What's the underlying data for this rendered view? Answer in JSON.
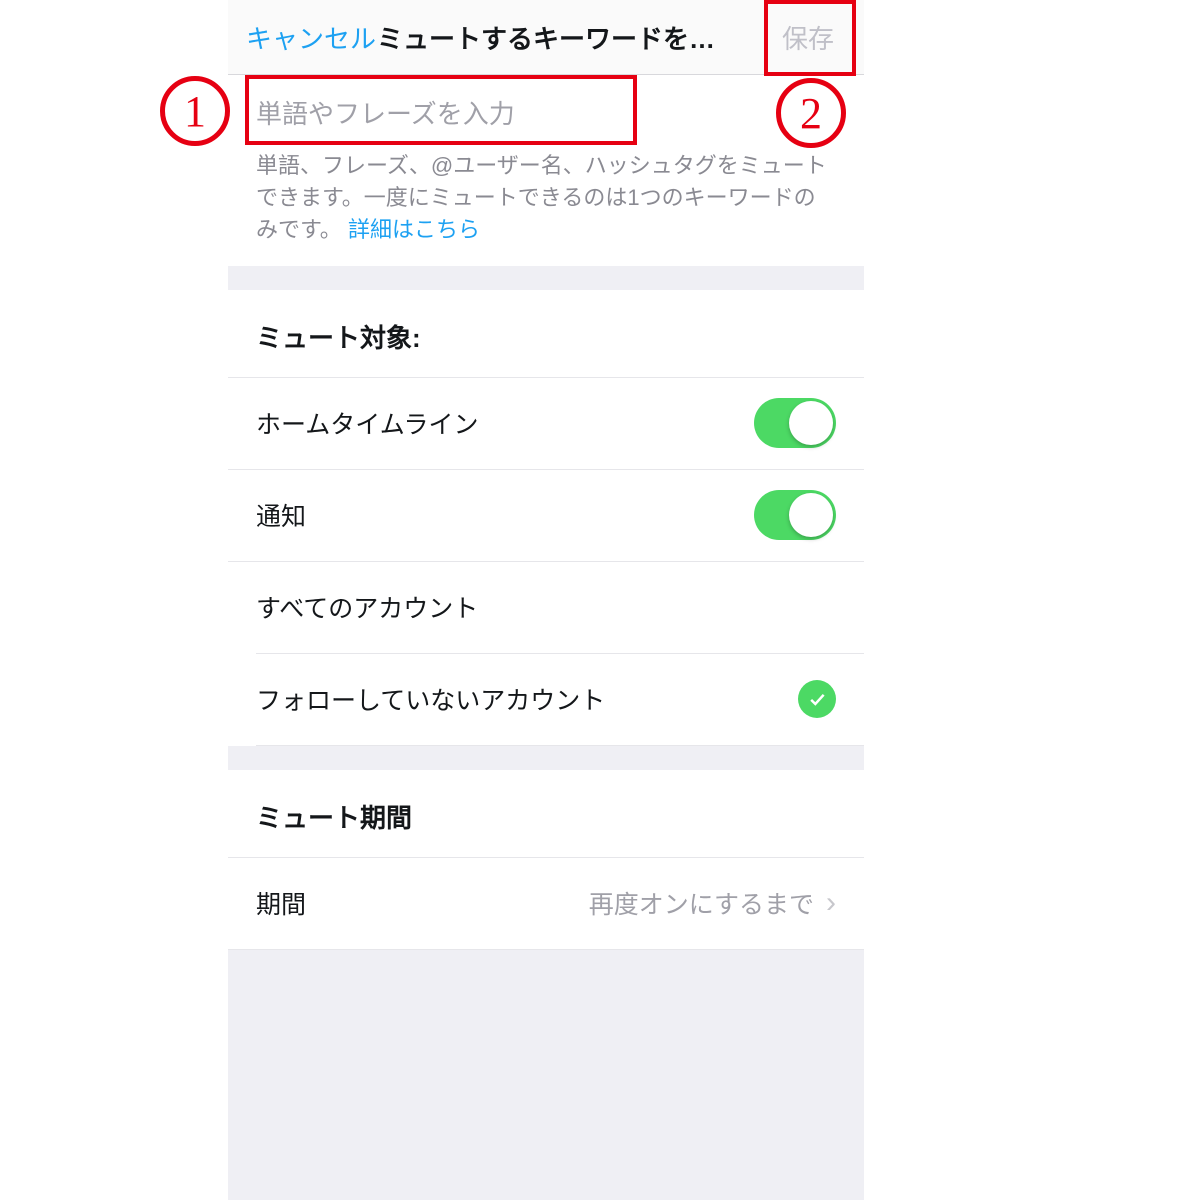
{
  "nav": {
    "cancel": "キャンセル",
    "title": "ミュートするキーワードを…",
    "save": "保存"
  },
  "input": {
    "placeholder": "単語やフレーズを入力",
    "help_text": "単語、フレーズ、@ユーザー名、ハッシュタグをミュートできます。一度にミュートできるのは1つのキーワードのみです。",
    "help_link": "詳細はこちら"
  },
  "mute_from": {
    "header": "ミュート対象:",
    "home_timeline": "ホームタイムライン",
    "notifications": "通知",
    "all_accounts": "すべてのアカウント",
    "not_following": "フォローしていないアカウント"
  },
  "mute_duration": {
    "header": "ミュート期間",
    "label": "期間",
    "value": "再度オンにするまで"
  },
  "annotations": {
    "one": "1",
    "two": "2"
  }
}
